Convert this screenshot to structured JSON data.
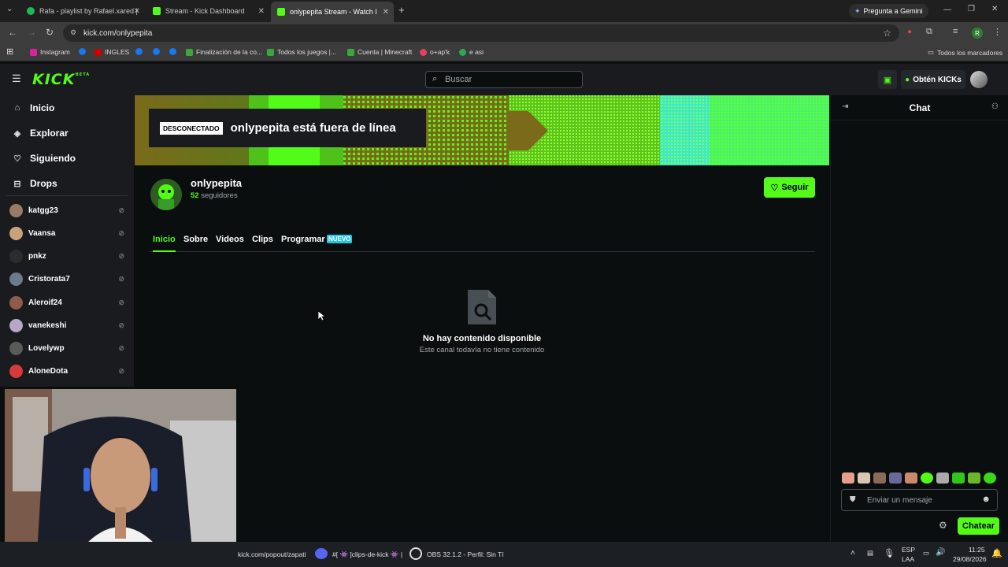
{
  "browser": {
    "tabs": [
      {
        "title": "Rafa - playlist by Rafael.xared |",
        "favicon_color": "#1db954",
        "active": false
      },
      {
        "title": "Stream - Kick Dashboard",
        "favicon_color": "#53fc18",
        "active": false
      },
      {
        "title": "onlypepita Stream - Watch Live",
        "favicon_color": "#53fc18",
        "active": true
      }
    ],
    "new_tab": "+",
    "gemini_label": "Pregunta a Gemini",
    "url": "kick.com/onlypepita",
    "bookmarks": [
      "Instagram",
      "INGLES",
      "Finalización de la co...",
      "Todos los juegos |...",
      "Cuenta | Minecraft",
      "o+ap'k",
      "e asi"
    ],
    "all_bookmarks": "Todos los marcadores"
  },
  "kick": {
    "logo": "KICK",
    "logo_tag": "BETA",
    "search_placeholder": "Buscar",
    "kicks_button": "Obtén KICKs",
    "brand_color": "#53fc18"
  },
  "sidebar": {
    "nav": [
      {
        "label": "Inicio",
        "icon": "home-icon"
      },
      {
        "label": "Explorar",
        "icon": "compass-icon"
      },
      {
        "label": "Siguiendo",
        "icon": "heart-icon"
      },
      {
        "label": "Drops",
        "icon": "gift-icon"
      }
    ],
    "channels": [
      {
        "name": "katgg23",
        "color": "#9a7b6a"
      },
      {
        "name": "Vaansa",
        "color": "#c9a27a"
      },
      {
        "name": "pnkz",
        "color": "#2c2c2c"
      },
      {
        "name": "Cristorata7",
        "color": "#6d7a8a"
      },
      {
        "name": "Aleroif24",
        "color": "#8f5b4a"
      },
      {
        "name": "vanekeshi",
        "color": "#b7a8c8"
      },
      {
        "name": "Lovelywp",
        "color": "#5a5a5a"
      },
      {
        "name": "AloneDota",
        "color": "#d63a3a"
      }
    ]
  },
  "channel": {
    "offline_badge": "DESCONECTADO",
    "offline_text": "onlypepita está fuera de línea",
    "name": "onlypepita",
    "followers_count": "52",
    "followers_label": "seguidores",
    "follow_button": "Seguir",
    "tabs": [
      "Inicio",
      "Sobre",
      "Videos",
      "Clips",
      "Programar"
    ],
    "new_badge": "NUEVO",
    "empty_title": "No hay contenido disponible",
    "empty_subtitle": "Este canal todavía no tiene contenido"
  },
  "chat": {
    "title": "Chat",
    "input_placeholder": "Enviar un mensaje",
    "send_button": "Chatear"
  },
  "taskbar": {
    "items": [
      "kick.com/popout/zapati",
      "#[ 👾 ]clips-de-kick 👾 |",
      "OBS 32.1.2 - Perfil: Sin Tí"
    ],
    "lang": "ESP",
    "lang_sub": "LAA",
    "time": "11:25",
    "date": "29/08/2026"
  }
}
